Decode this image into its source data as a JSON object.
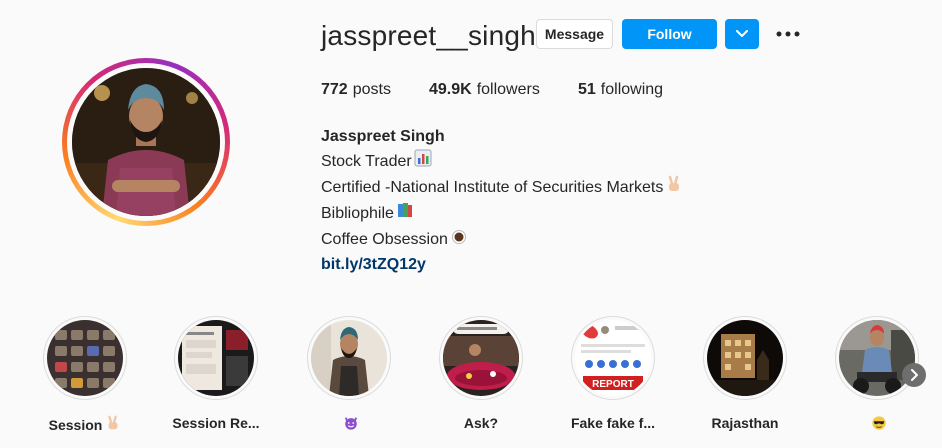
{
  "profile": {
    "username": "jasspreet__singh",
    "message_label": "Message",
    "follow_label": "Follow"
  },
  "stats": {
    "posts_count": "772",
    "posts_label": "posts",
    "followers_count": "49.9K",
    "followers_label": "followers",
    "following_count": "51",
    "following_label": "following"
  },
  "bio": {
    "name": "Jasspreet Singh",
    "lines": [
      {
        "text": "Stock Trader",
        "emoji": "chart-emoji"
      },
      {
        "text": "Certified -National Institute of Securities Markets",
        "emoji": "victory-hand-emoji"
      },
      {
        "text": "Bibliophile",
        "emoji": "books-emoji"
      },
      {
        "text": "Coffee Obsession",
        "emoji": "coffee-emoji"
      }
    ],
    "link": "bit.ly/3tZQ12y"
  },
  "highlights": [
    {
      "label": "Session",
      "emoji": "victory-hand-emoji"
    },
    {
      "label": "Session Re...",
      "emoji": ""
    },
    {
      "label": "",
      "emoji": "smiling-devil-emoji"
    },
    {
      "label": "Ask?",
      "emoji": ""
    },
    {
      "label": "Fake fake f...",
      "emoji": ""
    },
    {
      "label": "Rajasthan",
      "emoji": ""
    },
    {
      "label": "",
      "emoji": "sunglasses-emoji"
    }
  ],
  "highlight_texts": {
    "report_badge": "REPORT"
  },
  "colors": {
    "follow_blue": "#0095f6",
    "link_blue": "#00376b",
    "ring_gradient": [
      "#feda75",
      "#fa7e1e",
      "#d62976",
      "#962fbf"
    ]
  }
}
